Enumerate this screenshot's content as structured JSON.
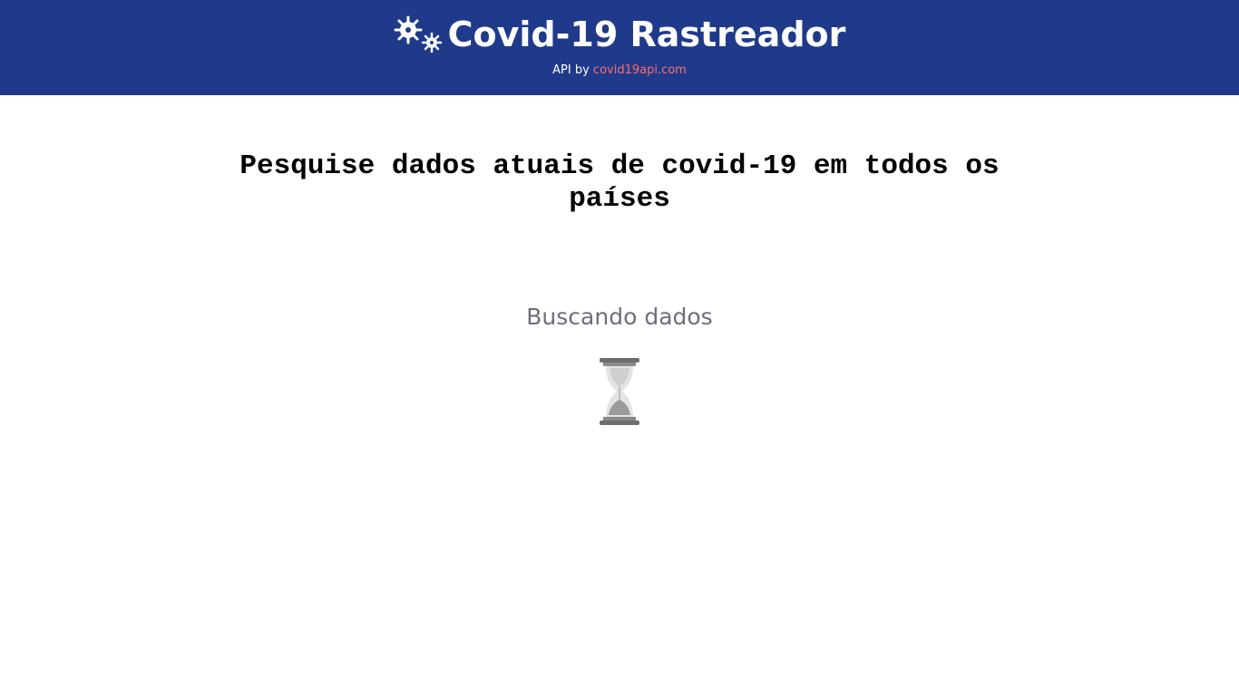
{
  "header": {
    "title": "Covid-19 Rastreador",
    "logo_icon": "virus-icon",
    "api_prefix": "API by",
    "api_link_text": "covid19api.com",
    "background_color": "#1f3a8a",
    "link_color": "#ff6b6b"
  },
  "main": {
    "heading": "Pesquise dados atuais de covid-19 em todos os países",
    "loading_text": "Buscando dados",
    "loading_icon": "hourglass-icon"
  }
}
